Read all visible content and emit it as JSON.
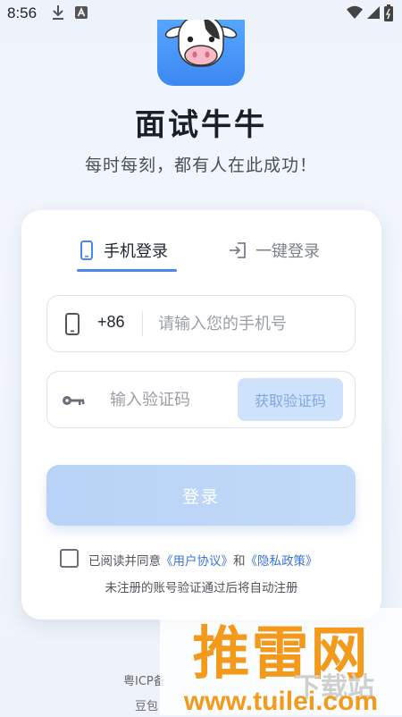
{
  "status_bar": {
    "time": "8:56"
  },
  "app": {
    "title": "面试牛牛",
    "slogan": "每时每刻，都有人在此成功！"
  },
  "tabs": [
    {
      "label": "手机登录",
      "active": true,
      "icon": "phone-icon"
    },
    {
      "label": "一键登录",
      "active": false,
      "icon": "login-arrow-icon"
    }
  ],
  "phone": {
    "country_code": "+86",
    "placeholder": "请输入您的手机号",
    "value": ""
  },
  "code": {
    "placeholder": "输入验证码",
    "value": "",
    "get_code_label": "获取验证码"
  },
  "login_label": "登录",
  "agreement": {
    "prefix": "已阅读并同意",
    "user_agreement": "《用户协议》",
    "conj": "和",
    "privacy_policy": "《隐私政策》",
    "checked": false,
    "notice": "未注册的账号验证通过后将自动注册"
  },
  "footer": {
    "icp": "粤ICP备",
    "line2": "豆包"
  },
  "watermark": {
    "brand": "推雷网",
    "gray_text": "下载站",
    "url": "www.tuilei.com"
  },
  "colors": {
    "accent": "#4a86ec",
    "button": "#c2daf8",
    "link": "#3a74d4",
    "watermark": "#f39a1c"
  }
}
